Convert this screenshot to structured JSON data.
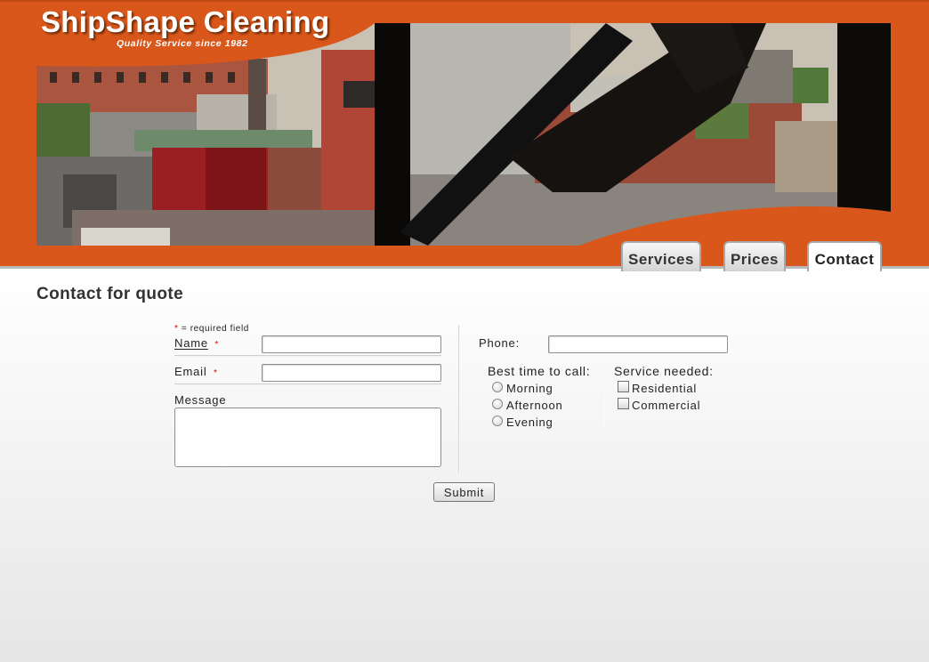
{
  "site": {
    "brand": "ShipShape Cleaning",
    "tagline": "Quality Service since 1982",
    "accent_color": "#d9571b"
  },
  "nav": {
    "tabs": [
      {
        "label": "Services",
        "active": false
      },
      {
        "label": "Prices",
        "active": false
      },
      {
        "label": "Contact",
        "active": true
      }
    ]
  },
  "page": {
    "title": "Contact for quote"
  },
  "form": {
    "required_note": "= required field",
    "required_marker": "*",
    "name": {
      "label": "Name",
      "value": ""
    },
    "email": {
      "label": "Email",
      "value": ""
    },
    "message": {
      "label": "Message",
      "value": ""
    },
    "phone": {
      "label": "Phone:",
      "value": ""
    },
    "best_time": {
      "heading": "Best time to call:",
      "options": [
        "Morning",
        "Afternoon",
        "Evening"
      ]
    },
    "service_needed": {
      "heading": "Service needed:",
      "options": [
        "Residential",
        "Commercial"
      ]
    },
    "submit_label": "Submit"
  }
}
